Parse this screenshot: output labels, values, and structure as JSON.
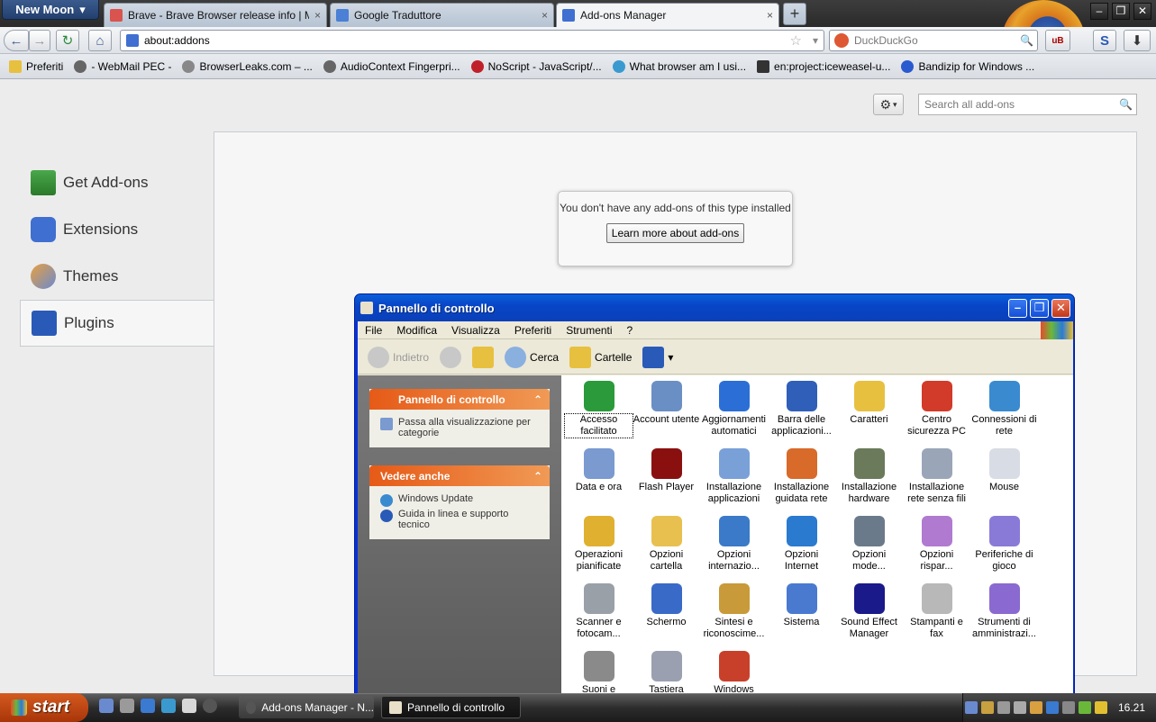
{
  "app_button": "New Moon",
  "tabs": [
    {
      "label": "Brave - Brave Browser release info | Malw...",
      "favicon": "brave-icon",
      "color": "#d9534f"
    },
    {
      "label": "Google Traduttore",
      "favicon": "google-translate-icon",
      "color": "#4a80d6"
    },
    {
      "label": "Add-ons Manager",
      "favicon": "puzzle-icon",
      "color": "#3f6fd0"
    }
  ],
  "tab_close": "×",
  "new_tab": "+",
  "window_controls": {
    "minimize": "–",
    "maximize": "❐",
    "close": "✕"
  },
  "nav": {
    "back": "←",
    "forward": "→",
    "reload": "↻",
    "home": "⌂",
    "url": "about:addons",
    "bookmark_star": "☆",
    "dropdown": "▾",
    "download": "⬇",
    "sync": "S",
    "ublock": "uB"
  },
  "search": {
    "engine": "DuckDuckGo",
    "placeholder": "DuckDuckGo",
    "go": "🔍"
  },
  "bookmarks": [
    {
      "label": "Preferiti"
    },
    {
      "label": "- WebMail PEC -"
    },
    {
      "label": "BrowserLeaks.com – ..."
    },
    {
      "label": "AudioContext Fingerpri..."
    },
    {
      "label": "NoScript - JavaScript/..."
    },
    {
      "label": "What browser am I usi..."
    },
    {
      "label": "en:project:iceweasel-u..."
    },
    {
      "label": "Bandizip for Windows ..."
    }
  ],
  "addons": {
    "gear": "⚙",
    "gear_caret": "▾",
    "search_placeholder": "Search all add-ons",
    "categories": [
      {
        "label": "Get Add-ons",
        "icon": "download-addons-icon"
      },
      {
        "label": "Extensions",
        "icon": "puzzle-piece-icon"
      },
      {
        "label": "Themes",
        "icon": "paintbrush-icon"
      },
      {
        "label": "Plugins",
        "icon": "lego-brick-icon",
        "selected": true
      }
    ],
    "empty_message": "You don't have any add-ons of this type installed",
    "learn_more": "Learn more about add-ons"
  },
  "control_panel": {
    "title": "Pannello di controllo",
    "menu": [
      "File",
      "Modifica",
      "Visualizza",
      "Preferiti",
      "Strumenti",
      "?"
    ],
    "toolbar": {
      "back": "Indietro",
      "search": "Cerca",
      "folders": "Cartelle"
    },
    "task_panels": [
      {
        "title": "Pannello di controllo",
        "items": [
          "Passa alla visualizzazione per categorie"
        ]
      },
      {
        "title": "Vedere anche",
        "items": [
          "Windows Update",
          "Guida in linea e supporto tecnico"
        ]
      }
    ],
    "collapse": "⌃",
    "icons": [
      {
        "label": "Accesso facilitato",
        "color": "#2a9a3a"
      },
      {
        "label": "Account utente",
        "color": "#6a8fc4"
      },
      {
        "label": "Aggiornamenti automatici",
        "color": "#2b6fd6"
      },
      {
        "label": "Barra delle applicazioni...",
        "color": "#2f5fb8"
      },
      {
        "label": "Caratteri",
        "color": "#e8c040"
      },
      {
        "label": "Centro sicurezza PC",
        "color": "#d23a2a"
      },
      {
        "label": "Connessioni di rete",
        "color": "#3a8ad0"
      },
      {
        "label": "Data e ora",
        "color": "#7a9ad0"
      },
      {
        "label": "Flash Player",
        "color": "#8a1010"
      },
      {
        "label": "Installazione applicazioni",
        "color": "#7aa0d8"
      },
      {
        "label": "Installazione guidata rete",
        "color": "#d86a2a"
      },
      {
        "label": "Installazione hardware",
        "color": "#6a7a5a"
      },
      {
        "label": "Installazione rete senza fili",
        "color": "#9aa6b8"
      },
      {
        "label": "Mouse",
        "color": "#d8dce4"
      },
      {
        "label": "Operazioni pianificate",
        "color": "#e0b030"
      },
      {
        "label": "Opzioni cartella",
        "color": "#e8c050"
      },
      {
        "label": "Opzioni internazio...",
        "color": "#3a7ac8"
      },
      {
        "label": "Opzioni Internet",
        "color": "#2a7ad0"
      },
      {
        "label": "Opzioni mode...",
        "color": "#6a7a8a"
      },
      {
        "label": "Opzioni rispar...",
        "color": "#b07ad0"
      },
      {
        "label": "Periferiche di gioco",
        "color": "#8a7ad8"
      },
      {
        "label": "Scanner e fotocam...",
        "color": "#9aa0a8"
      },
      {
        "label": "Schermo",
        "color": "#3a6ac8"
      },
      {
        "label": "Sintesi e riconoscime...",
        "color": "#c89a3a"
      },
      {
        "label": "Sistema",
        "color": "#4a7ad0"
      },
      {
        "label": "Sound Effect Manager",
        "color": "#1a1a8a"
      },
      {
        "label": "Stampanti e fax",
        "color": "#b8b8b8"
      },
      {
        "label": "Strumenti di amministrazi...",
        "color": "#8a6ad0"
      },
      {
        "label": "Suoni e",
        "color": "#8a8a8a"
      },
      {
        "label": "Tastiera",
        "color": "#9aa0b0"
      },
      {
        "label": "Windows",
        "color": "#c8402a"
      }
    ]
  },
  "taskbar": {
    "start": "start",
    "tasks": [
      {
        "label": "Add-ons Manager - N...",
        "active": false
      },
      {
        "label": "Pannello di controllo",
        "active": true
      }
    ],
    "clock": "16.21"
  }
}
